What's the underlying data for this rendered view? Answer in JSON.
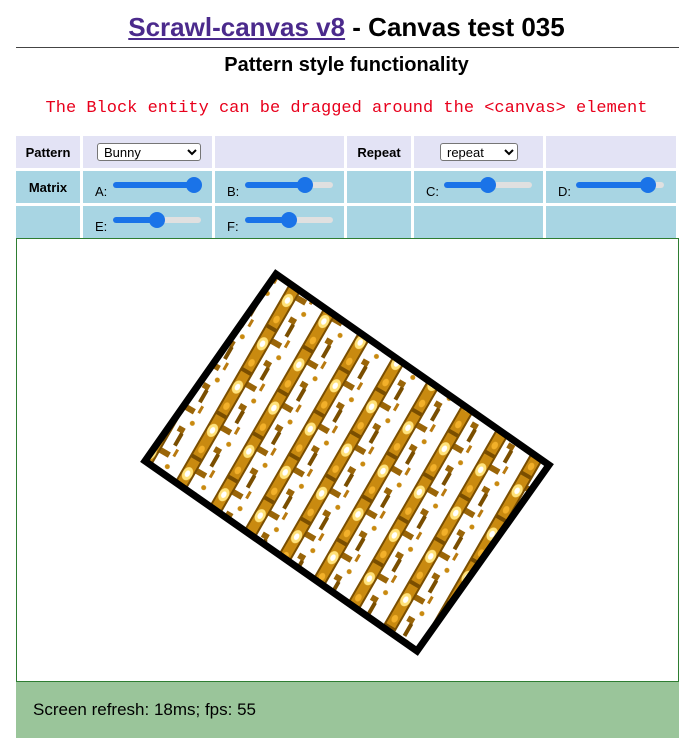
{
  "header": {
    "title_link": "Scrawl-canvas v8",
    "title_rest": " - Canvas test 035",
    "subtitle": "Pattern style functionality",
    "note": "The Block entity can be dragged around the <canvas> element"
  },
  "controls": {
    "pattern_label": "Pattern",
    "pattern_value": "Bunny",
    "repeat_label": "Repeat",
    "repeat_value": "repeat",
    "matrix_label": "Matrix",
    "sliders": [
      {
        "label": "A:",
        "value": 0.92
      },
      {
        "label": "B:",
        "value": 0.68
      },
      {
        "label": "C:",
        "value": 0.5
      },
      {
        "label": "D:",
        "value": 0.82
      },
      {
        "label": "E:",
        "value": 0.5
      },
      {
        "label": "F:",
        "value": 0.5
      }
    ]
  },
  "status": {
    "text": "Screen refresh: 18ms; fps: 55"
  }
}
